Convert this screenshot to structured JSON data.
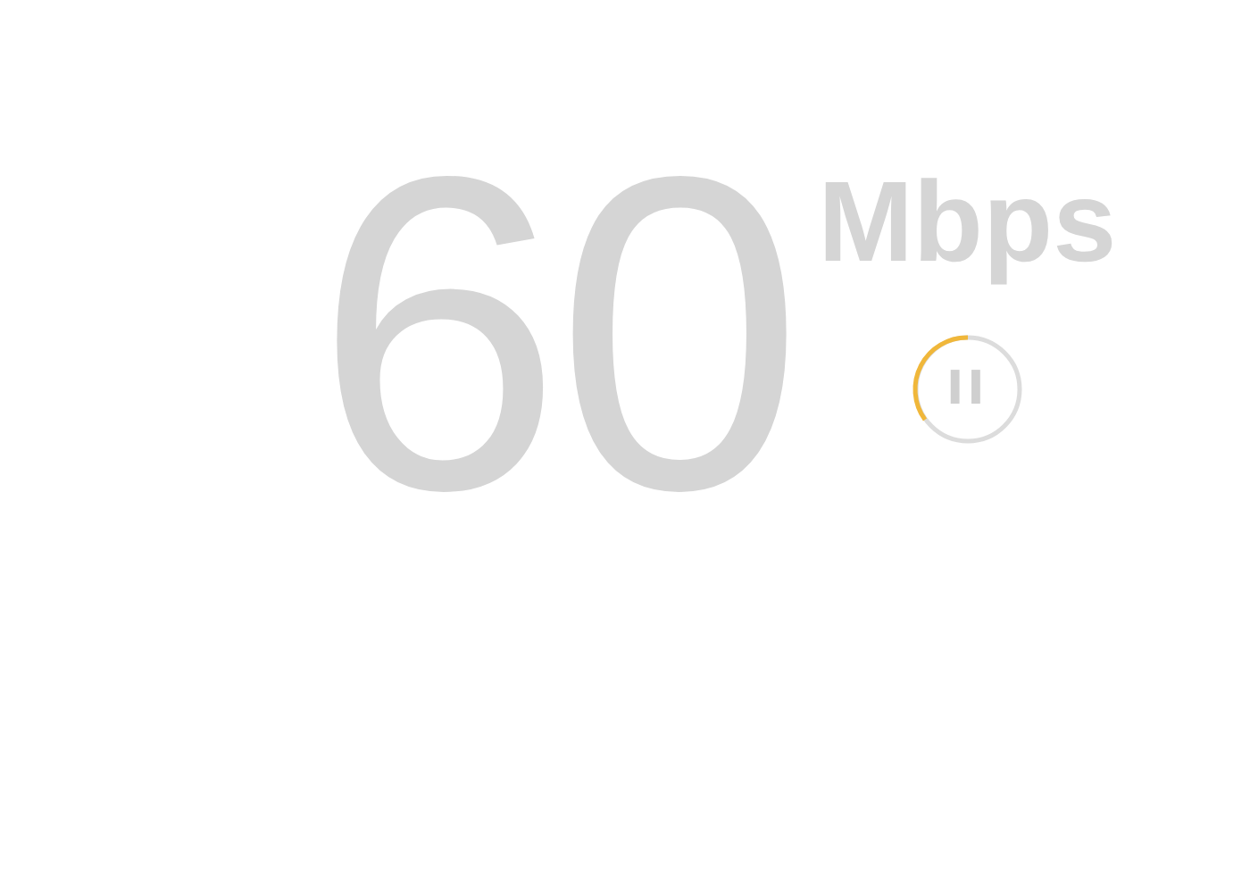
{
  "speed": {
    "value": "60",
    "unit": "Mbps"
  },
  "pause_button": {
    "label": "II"
  }
}
